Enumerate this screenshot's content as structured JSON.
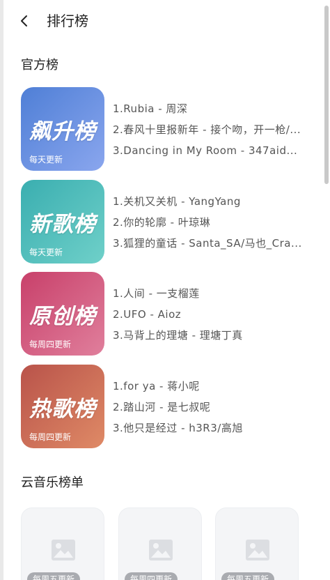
{
  "header": {
    "title": "排行榜"
  },
  "official": {
    "title": "官方榜",
    "charts": [
      {
        "cover_text": "飙升榜",
        "update": "每天更新",
        "colors": [
          "#4f7fd6",
          "#8aa6ee"
        ],
        "tracks": [
          "1.Rubia - 周深",
          "2.春风十里报新年 - 接个吻，开一枪/...",
          "3.Dancing in My Room - 347aid..."
        ]
      },
      {
        "cover_text": "新歌榜",
        "update": "每天更新",
        "colors": [
          "#3aaeb0",
          "#6fd0c9"
        ],
        "tracks": [
          "1.关机又关机 - YangYang",
          "2.你的轮廓 - 叶琼琳",
          "3.狐狸的童话 - Santa_SA/马也_Cra..."
        ]
      },
      {
        "cover_text": "原创榜",
        "update": "每周四更新",
        "colors": [
          "#c8406a",
          "#e07f9c"
        ],
        "tracks": [
          "1.人间 - 一支榴莲",
          "2.UFO - Aioz",
          "3.马背上的理塘 - 理塘丁真"
        ]
      },
      {
        "cover_text": "热歌榜",
        "update": "每周四更新",
        "colors": [
          "#b9534a",
          "#df8a66"
        ],
        "tracks": [
          "1.for ya - 蒋小呢",
          "2.踏山河 - 是七叔呢",
          "3.他只是经过 - h3R3/高旭"
        ]
      }
    ]
  },
  "cloud": {
    "title": "云音乐榜单",
    "cards": [
      {
        "badge": "每周五更新"
      },
      {
        "badge": "每周四更新"
      },
      {
        "badge": "每周五更新"
      }
    ]
  }
}
